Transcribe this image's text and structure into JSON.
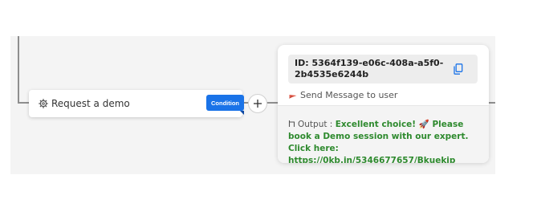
{
  "node": {
    "label": "Request a demo",
    "badge": "Condition"
  },
  "response_card": {
    "id_text": "ID: 5364f139-e06c-408a-a5f0-2b4535e6244b",
    "send_label": "Send Message to user",
    "output_label": "Output : ",
    "output_message": "Excellent choice! 🚀 Please book a Demo session with our expert. Click here: https://0kb.in/5346677657/Bkuekip"
  },
  "colors": {
    "accent_blue": "#1a73e8",
    "output_green": "#2e8a2e",
    "connector_gray": "#8e8e8e"
  },
  "icons": {
    "node_icon": "gear-icon",
    "add_icon": "plus-icon",
    "copy_icon": "copy-icon",
    "send_icon": "send-icon",
    "output_icon": "branch-icon"
  }
}
